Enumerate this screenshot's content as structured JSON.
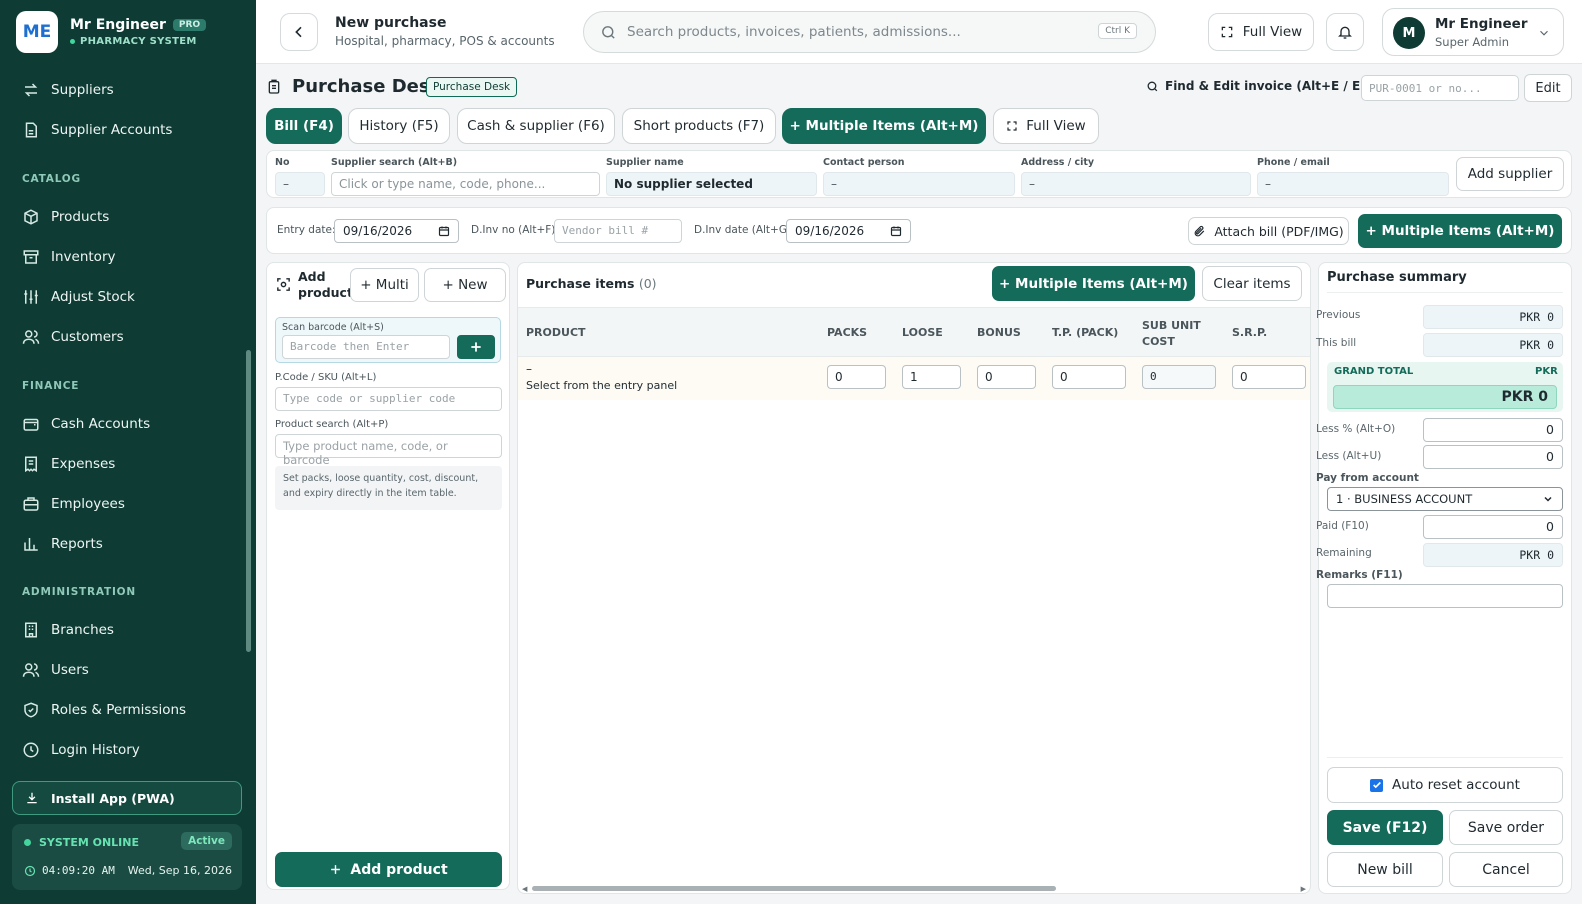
{
  "brand": {
    "logo_text": "ME",
    "name": "Mr Engineer",
    "badge": "PRO",
    "subtitle": "PHARMACY SYSTEM"
  },
  "sidebar": {
    "items_top": [
      {
        "label": "Suppliers",
        "icon": "swap-icon"
      },
      {
        "label": "Supplier Accounts",
        "icon": "document-icon"
      }
    ],
    "catalog_title": "CATALOG",
    "catalog": [
      {
        "label": "Products",
        "icon": "box-icon"
      },
      {
        "label": "Inventory",
        "icon": "archive-icon"
      },
      {
        "label": "Adjust Stock",
        "icon": "sliders-icon"
      },
      {
        "label": "Customers",
        "icon": "users-icon"
      }
    ],
    "finance_title": "FINANCE",
    "finance": [
      {
        "label": "Cash Accounts",
        "icon": "wallet-icon"
      },
      {
        "label": "Expenses",
        "icon": "receipt-icon"
      },
      {
        "label": "Employees",
        "icon": "briefcase-icon"
      },
      {
        "label": "Reports",
        "icon": "bar-chart-icon"
      }
    ],
    "admin_title": "ADMINISTRATION",
    "admin": [
      {
        "label": "Branches",
        "icon": "building-icon"
      },
      {
        "label": "Users",
        "icon": "users-icon"
      },
      {
        "label": "Roles & Permissions",
        "icon": "shield-icon"
      },
      {
        "label": "Login History",
        "icon": "clock-icon"
      }
    ],
    "install": "Install App (PWA)",
    "system": {
      "status": "SYSTEM ONLINE",
      "badge": "Active",
      "time": "04:09:20 AM",
      "date": "Wed, Sep 16, 2026"
    }
  },
  "header": {
    "title": "New purchase",
    "subtitle": "Hospital, pharmacy, POS & accounts",
    "search_placeholder": "Search products, invoices, patients, admissions...",
    "shortcut": "Ctrl K",
    "fullview": "Full View",
    "user_initial": "M",
    "user_name": "Mr Engineer",
    "user_role": "Super Admin"
  },
  "desk": {
    "title": "Purchase Desk",
    "badge": "Purchase Desk",
    "find_label": "Find & Edit invoice (Alt+E / Enter):",
    "find_placeholder": "PUR-0001 or no...",
    "edit": "Edit"
  },
  "tabs": [
    "Bill (F4)",
    "History (F5)",
    "Cash & supplier (F6)",
    "Short products (F7)",
    "+ Multiple Items (Alt+M)",
    "Full View"
  ],
  "supplier": {
    "no_label": "No",
    "no_value": "–",
    "search_label": "Supplier search (Alt+B)",
    "search_placeholder": "Click or type name, code, phone...",
    "name_label": "Supplier name",
    "name_value": "No supplier selected",
    "contact_label": "Contact person",
    "contact_value": "–",
    "address_label": "Address / city",
    "address_value": "–",
    "phone_label": "Phone / email",
    "phone_value": "–",
    "add_button": "Add supplier"
  },
  "entry": {
    "entry_date_label": "Entry date:",
    "entry_date": "09/16/2026",
    "dinv_label": "D.Inv no (Alt+F):",
    "dinv_placeholder": "Vendor bill #",
    "dinv_date_label": "D.Inv date (Alt+G):",
    "dinv_date": "09/16/2026",
    "attach": "Attach bill (PDF/IMG)",
    "multi": "+ Multiple Items (Alt+M)"
  },
  "entry_panel": {
    "add_product": "Add product",
    "multi": "+ Multi",
    "new": "+ New",
    "scan_label": "Scan barcode (Alt+S)",
    "scan_placeholder": "Barcode then Enter",
    "pcode_label": "P.Code / SKU (Alt+L)",
    "pcode_placeholder": "Type code or supplier code",
    "psearch_label": "Product search (Alt+P)",
    "psearch_placeholder": "Type product name, code, or barcode",
    "hint": "Set packs, loose quantity, cost, discount, and expiry directly in the item table.",
    "add_button": "Add product"
  },
  "items": {
    "title": "Purchase items",
    "count": "(0)",
    "multi": "+ Multiple Items (Alt+M)",
    "clear": "Clear items",
    "columns": [
      "PRODUCT",
      "PACKS",
      "LOOSE",
      "BONUS",
      "T.P. (PACK)",
      "SUB UNIT COST",
      "S.R.P."
    ],
    "row": {
      "product": "–",
      "hint": "Select from the entry panel",
      "packs": "0",
      "loose": "1",
      "bonus": "0",
      "tp": "0",
      "sub_cost": "0",
      "srp": "0"
    }
  },
  "summary": {
    "title": "Purchase summary",
    "previous_label": "Previous",
    "previous": "PKR 0",
    "this_bill_label": "This bill",
    "this_bill": "PKR 0",
    "grand_label": "GRAND TOTAL",
    "grand_currency": "PKR",
    "grand_total": "PKR 0",
    "less_pct_label": "Less % (Alt+O)",
    "less_pct": "0",
    "less_label": "Less (Alt+U)",
    "less": "0",
    "pay_label": "Pay from account",
    "pay_account": "1 · BUSINESS ACCOUNT",
    "paid_label": "Paid (F10)",
    "paid": "0",
    "remaining_label": "Remaining",
    "remaining": "PKR 0",
    "remarks_label": "Remarks (F11)",
    "auto_reset": "Auto reset account",
    "save": "Save (F12)",
    "save_order": "Save order",
    "new_bill": "New bill",
    "cancel": "Cancel"
  },
  "colors": {
    "sidebar": "#0f3b35",
    "accent": "#146b5a",
    "online": "#42d69e"
  }
}
